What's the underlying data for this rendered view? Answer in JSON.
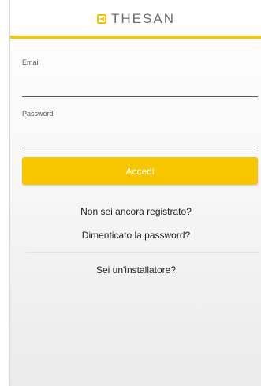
{
  "header": {
    "brand": "THESAN",
    "accent_color": "#f7c600",
    "logo_icon": "thesan-logo-icon"
  },
  "form": {
    "email_label": "Email",
    "email_value": "",
    "password_label": "Password",
    "password_value": "",
    "submit_label": "Accedi"
  },
  "links": {
    "register": "Non sei ancora registrato?",
    "forgot_password": "Dimenticato la password?",
    "installer": "Sei un'installatore?"
  }
}
